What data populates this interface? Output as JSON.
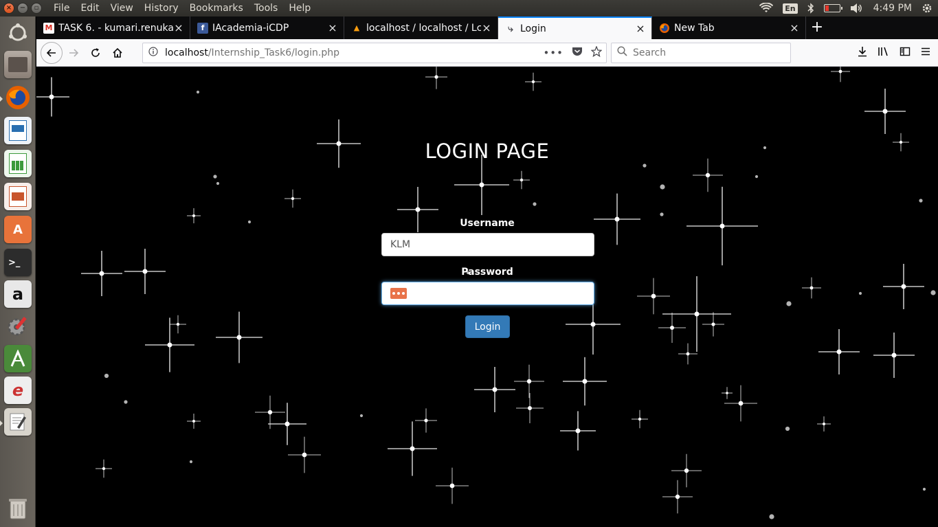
{
  "panel": {
    "menus": [
      "File",
      "Edit",
      "View",
      "History",
      "Bookmarks",
      "Tools",
      "Help"
    ],
    "keyboard_layout": "En",
    "clock": "4:49 PM"
  },
  "launcher": {
    "items": [
      {
        "name": "ubuntu-dash-icon",
        "color": "#5a5650"
      },
      {
        "name": "files-icon",
        "color": "#9a8f86"
      },
      {
        "name": "firefox-icon",
        "color": "#e66000"
      },
      {
        "name": "writer-icon",
        "color": "#2a6fb0"
      },
      {
        "name": "calc-icon",
        "color": "#3c9a3c"
      },
      {
        "name": "impress-icon",
        "color": "#c8552d"
      },
      {
        "name": "software-center-icon",
        "color": "#e8733a"
      },
      {
        "name": "terminal-icon",
        "color": "#2c2c2c"
      },
      {
        "name": "amazon-icon",
        "color": "#e8e8e8"
      },
      {
        "name": "system-settings-icon",
        "color": "#8a8a8a"
      },
      {
        "name": "android-studio-icon",
        "color": "#4a8a3a"
      },
      {
        "name": "eclipse-icon",
        "color": "#eeeeee"
      },
      {
        "name": "text-editor-icon",
        "color": "#d8d4cc"
      },
      {
        "name": "trash-icon",
        "color": "#8a8680"
      }
    ]
  },
  "tabs": [
    {
      "title": "TASK 6. - kumari.renuka",
      "favicon": "M",
      "favicon_color": "#d93025",
      "active": false
    },
    {
      "title": "IAcademia-iCDP",
      "favicon": "f",
      "favicon_color": "#3b5998",
      "active": false
    },
    {
      "title": "localhost / localhost / Lc",
      "favicon": "▲",
      "favicon_color": "#f89c0e",
      "active": false
    },
    {
      "title": "Login",
      "favicon": "⤷",
      "favicon_color": "#4a4a4f",
      "active": true
    },
    {
      "title": "New Tab",
      "favicon": "●",
      "favicon_color": "#e66000",
      "active": false
    }
  ],
  "urlbar": {
    "host": "localhost",
    "path": "/Internship_Task6/login.php"
  },
  "search": {
    "placeholder": "Search"
  },
  "login": {
    "title": "LOGIN PAGE",
    "username_label": "Username",
    "username_value": "KLM",
    "password_label": "Password",
    "button_label": "Login"
  }
}
